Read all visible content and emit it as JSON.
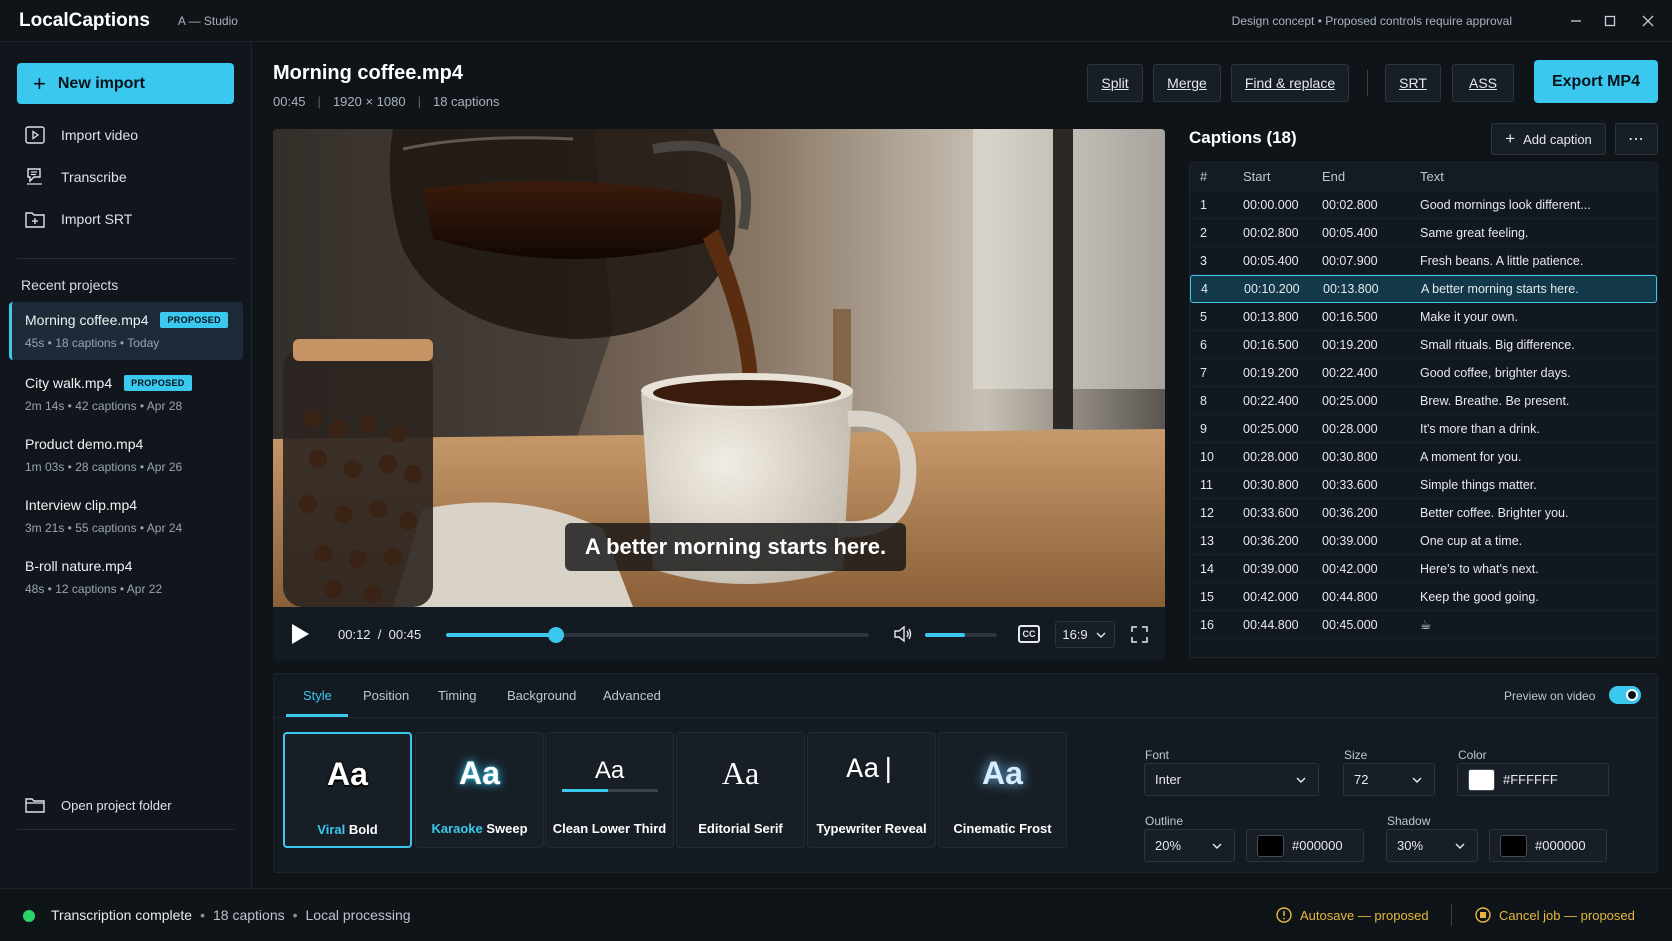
{
  "app": {
    "name": "LocalCaptions",
    "workspace": "A — Studio",
    "top_note": "Design concept • Proposed controls require approval"
  },
  "sidebar": {
    "new_import": "New import",
    "actions": [
      {
        "label": "Import video",
        "icon": "import-video-icon"
      },
      {
        "label": "Transcribe",
        "icon": "transcribe-icon"
      },
      {
        "label": "Import SRT",
        "icon": "import-srt-icon"
      }
    ],
    "recent_heading": "Recent projects",
    "projects": [
      {
        "title": "Morning coffee.mp4",
        "badge": "PROPOSED",
        "meta": "45s • 18 captions  •  Today",
        "active": true
      },
      {
        "title": "City walk.mp4",
        "badge": "PROPOSED",
        "meta": "2m 14s • 42 captions  •  Apr 28"
      },
      {
        "title": "Product demo.mp4",
        "badge": "",
        "meta": "1m 03s • 28 captions  •  Apr 26"
      },
      {
        "title": "Interview clip.mp4",
        "badge": "",
        "meta": "3m 21s • 55 captions  •  Apr 24"
      },
      {
        "title": "B-roll nature.mp4",
        "badge": "",
        "meta": "48s • 12 captions  •  Apr 22"
      }
    ],
    "open_folder": "Open project folder"
  },
  "header": {
    "title": "Morning coffee.mp4",
    "duration": "00:45",
    "resolution": "1920 × 1080",
    "caption_count": "18 captions",
    "buttons": {
      "split": "Split",
      "merge": "Merge",
      "find_replace": "Find & replace",
      "srt": "SRT",
      "ass": "ASS"
    },
    "export": "Export MP4"
  },
  "player": {
    "subtitle": "A better morning starts here.",
    "current_time": "00:12",
    "total_time": "00:45",
    "progress": 0.26,
    "volume": 0.55,
    "cc_label": "CC",
    "aspect": "16:9"
  },
  "captions": {
    "title": "Captions (18)",
    "add_button": "Add caption",
    "more_button": "⋯",
    "columns": [
      "#",
      "Start",
      "End",
      "Text"
    ],
    "rows": [
      [
        "1",
        "00:00.000",
        "00:02.800",
        "Good mornings look different..."
      ],
      [
        "2",
        "00:02.800",
        "00:05.400",
        "Same great feeling."
      ],
      [
        "3",
        "00:05.400",
        "00:07.900",
        "Fresh beans. A little patience."
      ],
      [
        "4",
        "00:10.200",
        "00:13.800",
        "A better morning starts here."
      ],
      [
        "5",
        "00:13.800",
        "00:16.500",
        "Make it your own."
      ],
      [
        "6",
        "00:16.500",
        "00:19.200",
        "Small rituals. Big difference."
      ],
      [
        "7",
        "00:19.200",
        "00:22.400",
        "Good coffee, brighter days."
      ],
      [
        "8",
        "00:22.400",
        "00:25.000",
        "Brew. Breathe. Be present."
      ],
      [
        "9",
        "00:25.000",
        "00:28.000",
        "It's more than a drink."
      ],
      [
        "10",
        "00:28.000",
        "00:30.800",
        "A moment for you."
      ],
      [
        "11",
        "00:30.800",
        "00:33.600",
        "Simple things matter."
      ],
      [
        "12",
        "00:33.600",
        "00:36.200",
        "Better coffee. Brighter you."
      ],
      [
        "13",
        "00:36.200",
        "00:39.000",
        "One cup at a time."
      ],
      [
        "14",
        "00:39.000",
        "00:42.000",
        "Here's to what's next."
      ],
      [
        "15",
        "00:42.000",
        "00:44.800",
        "Keep the good going."
      ],
      [
        "16",
        "00:44.800",
        "00:45.000",
        "☕"
      ]
    ],
    "active_row": 3
  },
  "style_panel": {
    "tabs": [
      "Style",
      "Position",
      "Timing",
      "Background",
      "Advanced"
    ],
    "active_tab": "Style",
    "preview_label": "Preview on video",
    "preview_on": true,
    "presets": [
      {
        "sample": "Aa",
        "label_a": "Viral",
        "label_b": "Bold",
        "active": true
      },
      {
        "sample": "Aa",
        "label_a": "Karaoke",
        "label_b": "Sweep"
      },
      {
        "sample": "Aa",
        "label_a": "Clean Lower Third",
        "label_b": ""
      },
      {
        "sample": "Aa",
        "label_a": "Editorial Serif",
        "label_b": ""
      },
      {
        "sample": "Aa|",
        "label_a": "Typewriter Reveal",
        "label_b": ""
      },
      {
        "sample": "Aa",
        "label_a": "Cinematic Frost",
        "label_b": ""
      }
    ],
    "font_label": "Font",
    "font_value": "Inter",
    "size_label": "Size",
    "size_value": "72",
    "color_label": "Color",
    "color_value": "#FFFFFF",
    "outline_label": "Outline",
    "outline_value": "20%",
    "outline_color": "#000000",
    "shadow_label": "Shadow",
    "shadow_value": "30%",
    "shadow_color": "#000000"
  },
  "status": {
    "text": "Transcription complete",
    "captions": "18 captions",
    "processing": "Local processing",
    "autosave": "Autosave — proposed",
    "cancel": "Cancel job — proposed"
  },
  "colors": {
    "accent": "#3bc8ef",
    "ok": "#2bd46a",
    "warn": "#e6b73c",
    "bg": "#0f1419"
  }
}
